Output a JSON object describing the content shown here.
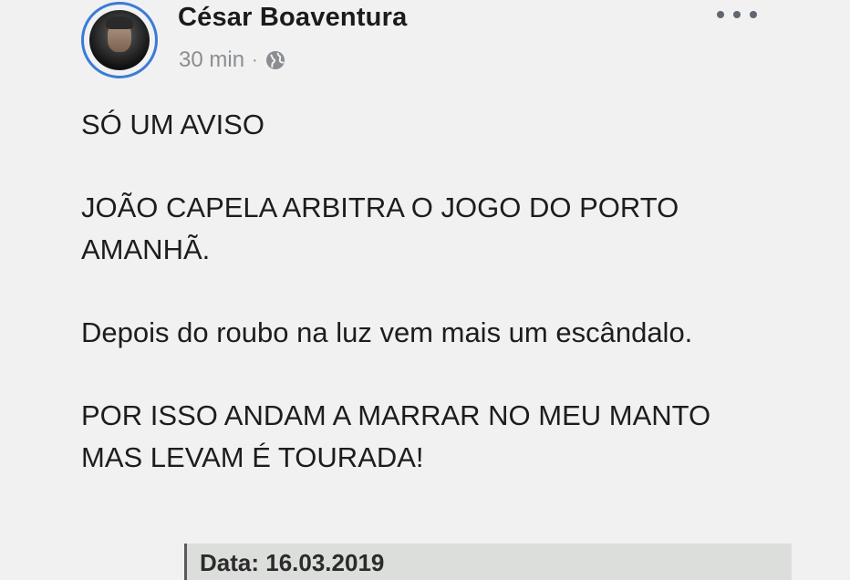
{
  "post": {
    "author_name": "César Boaventura",
    "timestamp": "30 min",
    "separator": "·",
    "privacy_icon": "globe-icon",
    "more_icon": "more-options-icon",
    "accent_color": "#3b7bd6",
    "paragraphs": [
      "SÓ UM AVISO",
      "JOÃO CAPELA ARBITRA O JOGO DO PORTO AMANHÃ.",
      "Depois do roubo na luz vem mais um escândalo.",
      "POR ISSO ANDAM A MARRAR NO MEU MANTO MAS LEVAM É TOURADA!"
    ],
    "attachment": {
      "text": "Data: 16.03.2019"
    }
  }
}
